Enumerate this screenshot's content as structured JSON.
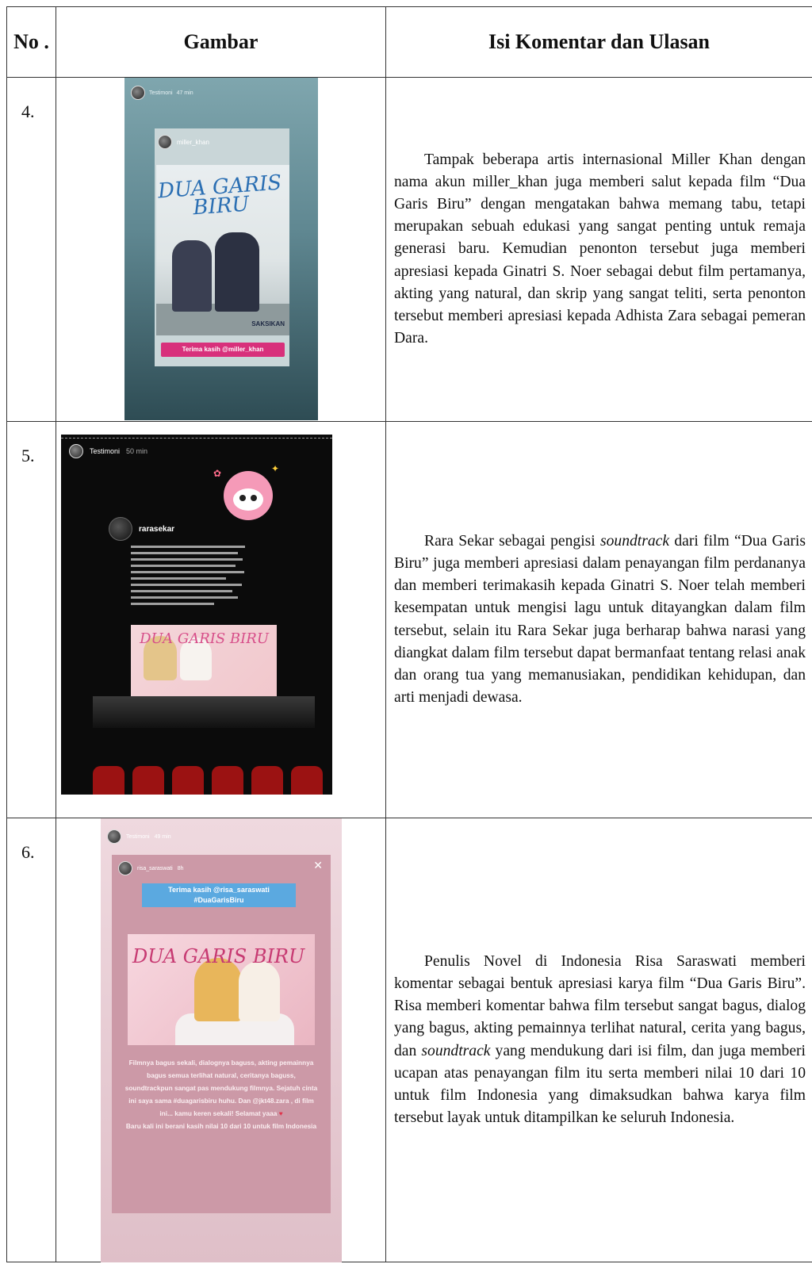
{
  "table": {
    "headers": {
      "no": "No .",
      "gambar": "Gambar",
      "isi": "Isi Komentar dan Ulasan"
    },
    "rows": [
      {
        "no": "4.",
        "image": {
          "header_account": "Testimoni",
          "header_time": "47 min",
          "user": "miller_khan",
          "poster_title": "DUA GARIS BIRU",
          "poster_brand": "SAKSIKAN",
          "caption": "Terima kasih @miller_khan"
        },
        "text": "Tampak beberapa artis internasional Miller Khan dengan nama akun miller_khan juga memberi salut kepada film “Dua Garis Biru” dengan mengatakan bahwa memang tabu, tetapi merupakan sebuah edukasi yang sangat penting untuk remaja generasi baru. Kemudian penonton tersebut juga memberi apresiasi kepada Ginatri S. Noer sebagai debut film pertamanya, akting yang natural, dan skrip yang sangat teliti, serta penonton tersebut memberi apresiasi kepada Adhista Zara sebagai pemeran Dara."
      },
      {
        "no": "5.",
        "image": {
          "header_account": "Testimoni",
          "header_time": "50 min",
          "user": "rarasekar",
          "poster_title": "DUA GARIS BIRU"
        },
        "text_before": "Rara Sekar sebagai pengisi ",
        "text_italic": "soundtrack",
        "text_after": " dari film “Dua Garis Biru” juga memberi apresiasi dalam penayangan film perdananya dan memberi terimakasih kepada Ginatri S. Noer telah memberi kesempatan untuk mengisi lagu untuk ditayangkan dalam film tersebut, selain itu Rara Sekar juga berharap bahwa narasi yang diangkat dalam film tersebut dapat bermanfaat tentang relasi anak dan orang tua yang memanusiakan, pendidikan kehidupan, dan arti menjadi dewasa."
      },
      {
        "no": "6.",
        "image": {
          "header_account": "Testimoni",
          "header_time": "49 min",
          "user": "risa_saraswati",
          "user_time": "8h",
          "thanks_line1": "Terima kasih @risa_saraswati",
          "thanks_line2": "#DuaGarisBiru",
          "poster_title": "DUA GARIS BIRU",
          "caption": "Filmnya bagus sekali, dialognya baguss, akting pemainnya bagus semua terlihat natural, ceritanya baguss, soundtrackpun sangat pas mendukung filmnya. Sejatuh cinta ini saya sama #duagarisbiru huhu. Dan @jkt48.zara , di film ini... kamu keren sekali! Selamat yaaa",
          "caption2": "Baru kali ini berani kasih nilai 10 dari 10 untuk film Indonesia"
        },
        "text_before": "Penulis Novel di Indonesia Risa Saraswati memberi komentar sebagai bentuk apresiasi karya film “Dua Garis Biru”. Risa memberi komentar bahwa film tersebut sangat bagus, dialog yang bagus, akting pemainnya terlihat natural, cerita yang bagus, dan ",
        "text_italic": "soundtrack",
        "text_after": " yang mendukung dari isi film, dan juga memberi ucapan atas penayangan film itu serta memberi nilai 10 dari 10 untuk film Indonesia yang dimaksudkan bahwa karya film tersebut layak untuk ditampilkan ke seluruh Indonesia."
      }
    ]
  }
}
